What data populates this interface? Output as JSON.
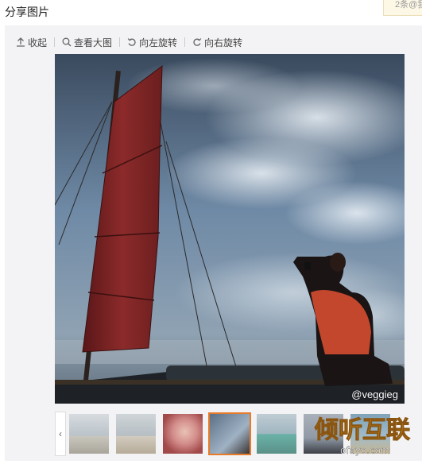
{
  "header": {
    "title": "分享图片"
  },
  "corner_tip": {
    "text": "2条@我"
  },
  "toolbar": {
    "collapse_label": "收起",
    "view_large_label": "查看大图",
    "rotate_left_label": "向左旋转",
    "rotate_right_label": "向右旋转"
  },
  "image": {
    "watermark": "@veggieg"
  },
  "thumbnails": {
    "prev_label": "‹",
    "count": 7,
    "active_index": 3
  },
  "site_logo": {
    "text": "倾听互联",
    "domain": "ofayo.com"
  },
  "colors": {
    "accent": "#e87b2a",
    "panel_bg": "#f3f3f5"
  }
}
